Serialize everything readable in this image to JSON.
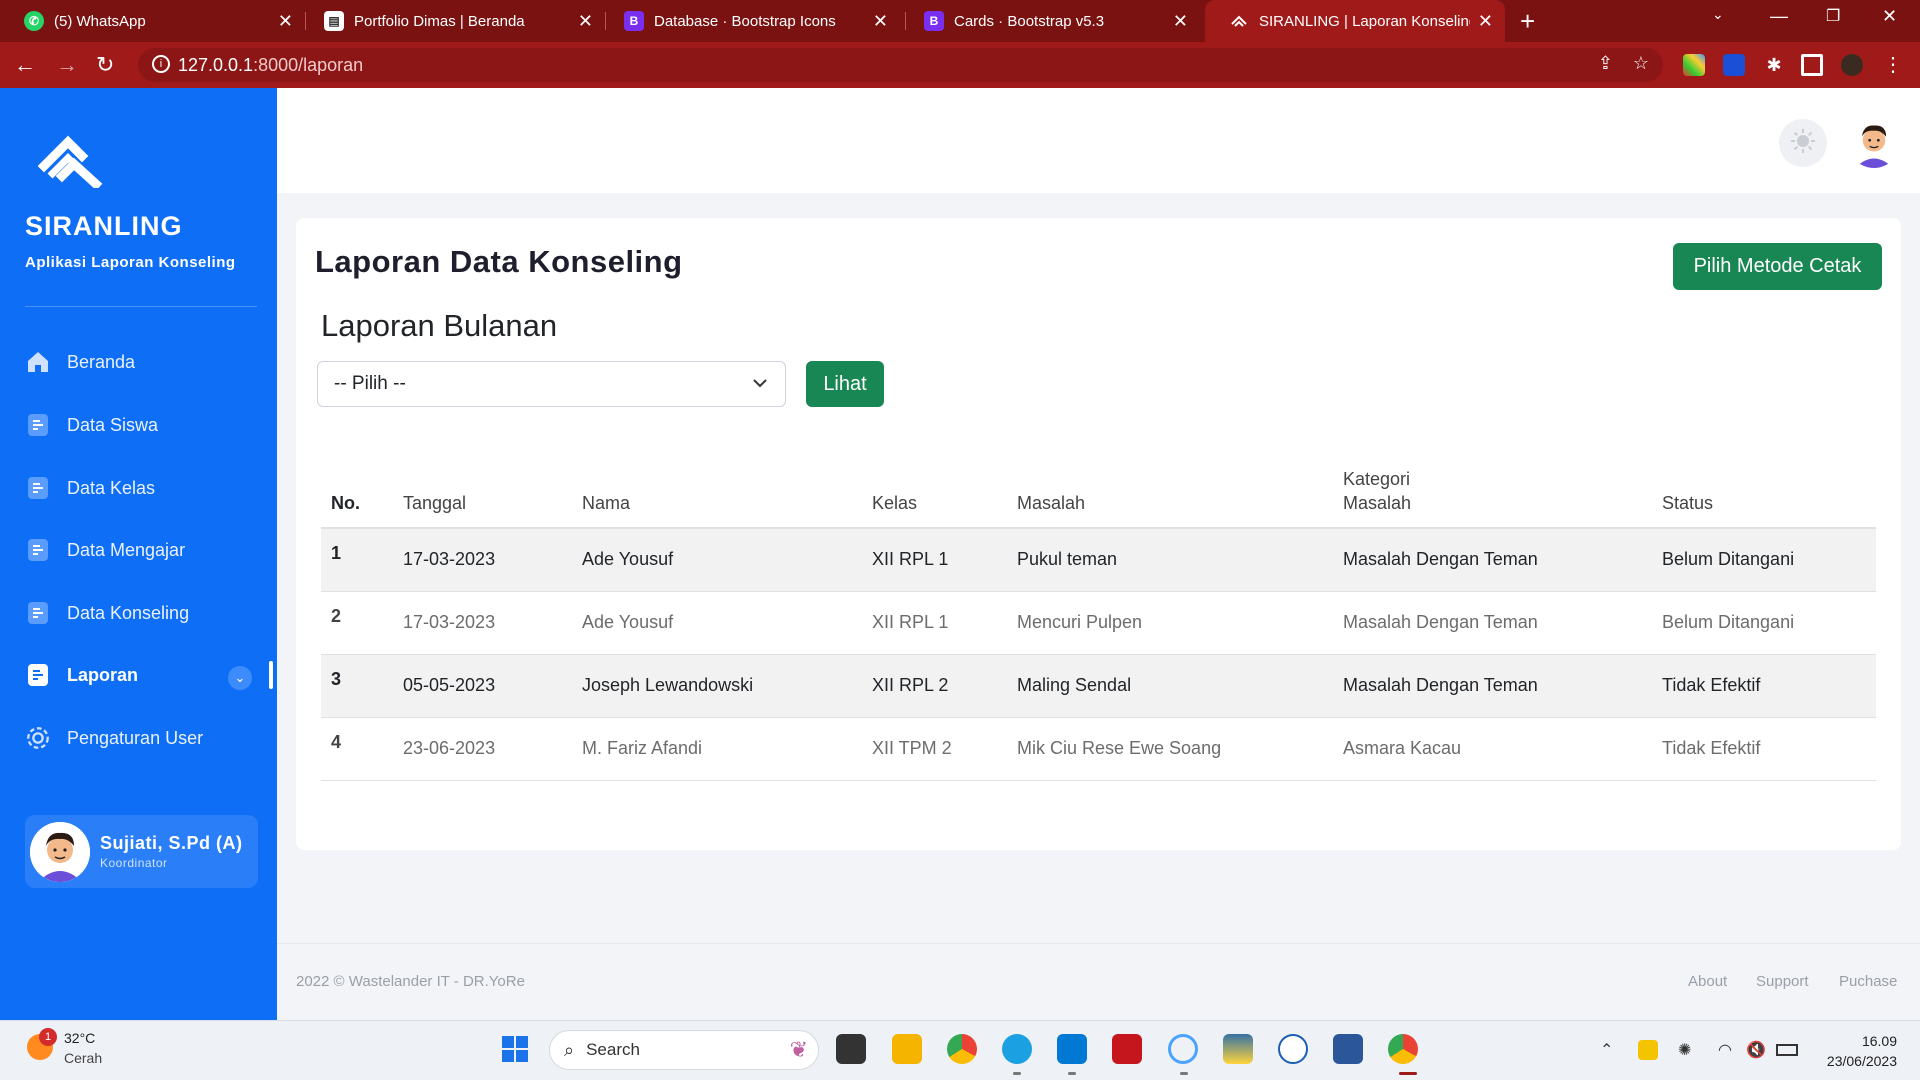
{
  "browser": {
    "tabs": [
      {
        "title": "(5) WhatsApp",
        "icon": "whatsapp-icon"
      },
      {
        "title": "Portfolio Dimas | Beranda",
        "icon": "page-icon"
      },
      {
        "title": "Database · Bootstrap Icons",
        "icon": "bootstrap-icon",
        "icon_text": "B"
      },
      {
        "title": "Cards · Bootstrap v5.3",
        "icon": "bootstrap-icon",
        "icon_text": "B"
      },
      {
        "title": "SIRANLING | Laporan Konseling",
        "icon": "siranling-icon"
      }
    ],
    "tab_close": "✕",
    "new_tab": "+",
    "url_host": "127.0.0.1",
    "url_path": ":8000/laporan",
    "tab_chrome_color": "#7a1212"
  },
  "sidebar": {
    "brand": "SIRANLING",
    "subtitle": "Aplikasi Laporan Konseling",
    "items": [
      {
        "label": "Beranda",
        "icon": "home-icon"
      },
      {
        "label": "Data Siswa",
        "icon": "list-icon"
      },
      {
        "label": "Data Kelas",
        "icon": "list-icon"
      },
      {
        "label": "Data Mengajar",
        "icon": "list-icon"
      },
      {
        "label": "Data Konseling",
        "icon": "list-icon"
      },
      {
        "label": "Laporan",
        "icon": "list-icon",
        "active": true
      },
      {
        "label": "Pengaturan User",
        "icon": "gear-icon"
      }
    ],
    "user": {
      "name": "Sujiati, S.Pd (A)",
      "role": "Koordinator"
    },
    "color": "#0f6ef6"
  },
  "main": {
    "title": "Laporan Data Konseling",
    "print_button": "Pilih Metode Cetak",
    "subtitle": "Laporan Bulanan",
    "select_value": "-- Pilih --",
    "view_button": "Lihat",
    "table": {
      "headers": [
        "No.",
        "Tanggal",
        "Nama",
        "Kelas",
        "Masalah",
        "Kategori Masalah",
        "Status"
      ],
      "rows": [
        [
          "1",
          "17-03-2023",
          "Ade Yousuf",
          "XII RPL 1",
          "Pukul teman",
          "Masalah Dengan Teman",
          "Belum Ditangani"
        ],
        [
          "2",
          "17-03-2023",
          "Ade Yousuf",
          "XII RPL 1",
          "Mencuri Pulpen",
          "Masalah Dengan Teman",
          "Belum Ditangani"
        ],
        [
          "3",
          "05-05-2023",
          "Joseph Lewandowski",
          "XII RPL 2",
          "Maling Sendal",
          "Masalah Dengan Teman",
          "Tidak Efektif"
        ],
        [
          "4",
          "23-06-2023",
          "M. Fariz Afandi",
          "XII TPM 2",
          "Mik Ciu Rese Ewe Soang",
          "Asmara Kacau",
          "Tidak Efektif"
        ]
      ]
    },
    "accent": "#198754"
  },
  "footer": {
    "copyright": "2022 © Wastelander IT - DR.YoRe",
    "links": [
      "About",
      "Support",
      "Puchase"
    ]
  },
  "taskbar": {
    "temperature": "32°C",
    "condition": "Cerah",
    "weather_badge": "1",
    "search_label": "Search",
    "time": "16.09",
    "date": "23/06/2023"
  }
}
